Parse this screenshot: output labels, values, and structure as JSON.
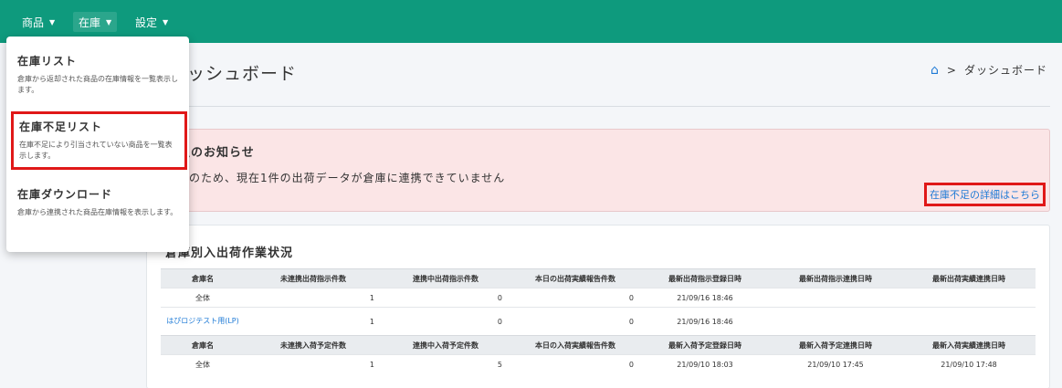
{
  "nav": {
    "items": [
      {
        "label": "商品"
      },
      {
        "label": "在庫"
      },
      {
        "label": "設定"
      }
    ]
  },
  "page": {
    "title": "ッシュボード",
    "breadcrumb": "ダッシュボード"
  },
  "alert": {
    "title": "不足のお知らせ",
    "message": "不足のため、現在1件の出荷データが倉庫に連携できていません",
    "link": "在庫不足の詳細はこちら"
  },
  "card": {
    "title": "倉庫別入出荷作業状況",
    "outbound_headers": [
      "倉庫名",
      "未連携出荷指示件数",
      "連携中出荷指示件数",
      "本日の出荷実績報告件数",
      "最新出荷指示登録日時",
      "最新出荷指示連携日時",
      "最新出荷実績連携日時"
    ],
    "outbound_rows": [
      [
        "全体",
        "1",
        "0",
        "0",
        "21/09/16 18:46",
        "",
        ""
      ],
      [
        "はぴロジテスト用(LP)",
        "1",
        "0",
        "0",
        "21/09/16 18:46",
        "",
        ""
      ]
    ],
    "inbound_headers": [
      "倉庫名",
      "未連携入荷予定件数",
      "連携中入荷予定件数",
      "本日の入荷実績報告件数",
      "最新入荷予定登録日時",
      "最新入荷予定連携日時",
      "最新入荷実績連携日時"
    ],
    "inbound_rows": [
      [
        "全体",
        "1",
        "5",
        "0",
        "21/09/10 18:03",
        "21/09/10 17:45",
        "21/09/10 17:48"
      ]
    ]
  },
  "dropdown": {
    "items": [
      {
        "title": "在庫リスト",
        "desc": "倉庫から返却された商品の在庫情報を一覧表示します。"
      },
      {
        "title": "在庫不足リスト",
        "desc": "在庫不足により引当されていない商品を一覧表示します。"
      },
      {
        "title": "在庫ダウンロード",
        "desc": "倉庫から連携された商品在庫情報を表示します。"
      }
    ]
  },
  "colors": {
    "topbar": "#0e9a7d",
    "link": "#1e7ad6",
    "highlight": "#e01818",
    "alert_bg": "#fbe5e6"
  }
}
